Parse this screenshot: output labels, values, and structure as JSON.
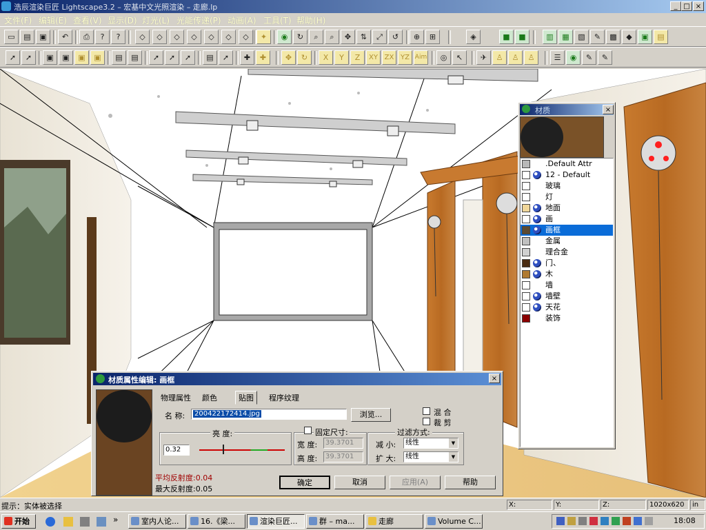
{
  "window": {
    "title": "浩辰渲染巨匠 Lightscape3.2 – 宏基中文光照渲染 – 走廊.lp",
    "controls": {
      "minimize": "_",
      "maximize": "□",
      "close": "×"
    }
  },
  "menu": [
    "文件(F)",
    "编辑(E)",
    "查看(V)",
    "显示(D)",
    "灯光(L)",
    "光能传递(P)",
    "动画(A)",
    "工具(T)",
    "帮助(H)"
  ],
  "toolbar2_text": {
    "x": "X",
    "y": "Y",
    "z": "Z",
    "xy": "XY",
    "zx": "ZX",
    "yz": "YZ",
    "aim": "Aim"
  },
  "materials_panel": {
    "title": "材质",
    "items": [
      {
        "name": ".Default Attr",
        "color": "#b8b8b8",
        "cube": false
      },
      {
        "name": "12 - Default",
        "color": "#ffffff",
        "cube": true
      },
      {
        "name": "玻璃",
        "color": "#ffffff",
        "cube": false
      },
      {
        "name": "灯",
        "color": "#ffffff",
        "cube": false
      },
      {
        "name": "地面",
        "color": "#f1d79a",
        "cube": true
      },
      {
        "name": "画",
        "color": "#ffffff",
        "cube": true
      },
      {
        "name": "画框",
        "color": "#5c4a32",
        "cube": true
      },
      {
        "name": "金属",
        "color": "#c0c0c0",
        "cube": false
      },
      {
        "name": "理合金",
        "color": "#d0d0d0",
        "cube": false
      },
      {
        "name": "门、",
        "color": "#4a2c12",
        "cube": true
      },
      {
        "name": "木",
        "color": "#b07a30",
        "cube": true
      },
      {
        "name": "墙",
        "color": "#ffffff",
        "cube": false
      },
      {
        "name": "墙壁",
        "color": "#ffffff",
        "cube": true
      },
      {
        "name": "天花",
        "color": "#ffffff",
        "cube": true
      },
      {
        "name": "装饰",
        "color": "#8b0000",
        "cube": false
      }
    ],
    "selected_index": 6
  },
  "dialog": {
    "title": "材质属性编辑: 画框",
    "tabs": [
      "物理属性",
      "颜色",
      "贴图",
      "程序纹理"
    ],
    "active_tab": 2,
    "name_label": "名  称:",
    "name_value": "200422172414.jpg",
    "browse": "浏览...",
    "mix": "混  合",
    "crop": "裁  剪",
    "brightness_label": "亮  度:",
    "brightness_value": "0.32",
    "fixed_size": "固定尺寸:",
    "width_label": "宽  度:",
    "width_value": "39.3701",
    "height_label": "高  度:",
    "height_value": "39.3701",
    "filter_label": "过滤方式:",
    "min_label": "减  小:",
    "min_value": "线性",
    "mag_label": "扩  大:",
    "mag_value": "线性",
    "avg_reflect": "平均反射度:0.04",
    "max_reflect": "最大反射度:0.05",
    "ok": "确定",
    "cancel": "取消",
    "apply": "应用(A)",
    "help": "帮助"
  },
  "statusbar": {
    "hint": "提示：实体被选择",
    "x": "X:",
    "y": "Y:",
    "z": "Z:",
    "resolution": "1020x620",
    "unit": "in"
  },
  "taskbar": {
    "start": "开始",
    "tasks": [
      "室内人论...",
      "16.《梁...",
      "渲染巨匠...",
      "群 – ma...",
      "走廊",
      "Volume C..."
    ],
    "active_task": 2,
    "time": "18:08"
  }
}
